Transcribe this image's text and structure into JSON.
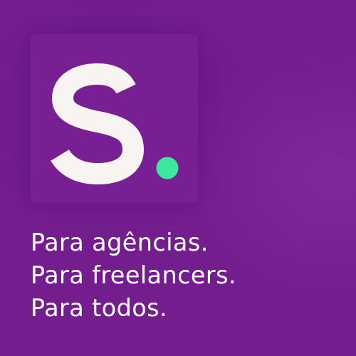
{
  "logo": {
    "letter": "S",
    "dot_color": "#3ee89a",
    "letter_color": "#f7f4f2",
    "card_color": "#781f93"
  },
  "background_color": "#731d8f",
  "tagline": [
    "Para agências.",
    "Para freelancers.",
    "Para todos."
  ]
}
